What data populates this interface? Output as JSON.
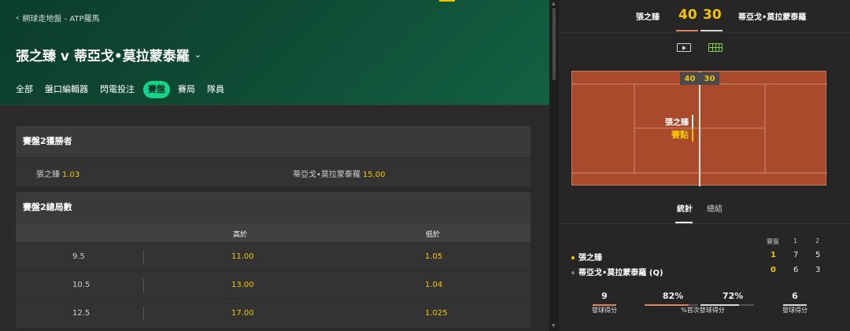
{
  "breadcrumb": "網球走地盤 - ATP羅馬",
  "match_title": "張之臻 v 蒂亞戈•莫拉蒙泰羅",
  "tabs": [
    {
      "label": "全部"
    },
    {
      "label": "盤口編輯器"
    },
    {
      "label": "閃電投注"
    },
    {
      "label": "賽盤"
    },
    {
      "label": "賽局"
    },
    {
      "label": "隊員"
    }
  ],
  "active_tab": "賽盤",
  "set_winner_market": {
    "title": "賽盤2獲勝者",
    "selections": [
      {
        "name": "張之臻",
        "odds": "1.03"
      },
      {
        "name": "蒂亞戈•莫拉蒙泰羅",
        "odds": "15.00"
      }
    ]
  },
  "total_games_market": {
    "title": "賽盤2總局數",
    "col_over": "高於",
    "col_under": "低於",
    "rows": [
      {
        "line": "9.5",
        "over": "11.00",
        "under": "1.05"
      },
      {
        "line": "10.5",
        "over": "13.00",
        "under": "1.04"
      },
      {
        "line": "12.5",
        "over": "17.00",
        "under": "1.025"
      }
    ]
  },
  "scoreboard": {
    "player1": "張之臻",
    "player2": "蒂亞戈•莫拉蒙泰羅",
    "points1": "40",
    "points2": "30",
    "underline1_color": "#e0835c",
    "underline2_color": "#d8d8d8"
  },
  "view_icons": [
    "video-icon",
    "court-view-icon"
  ],
  "court": {
    "score1": "40",
    "score2": "30",
    "server_name": "張之臻",
    "status": "賽點",
    "surface_color": "#a94a2b"
  },
  "stats_tabs": {
    "stats": "統計",
    "summary": "總結"
  },
  "sets_table": {
    "header": [
      "賽盤",
      "1",
      "2"
    ],
    "players": [
      {
        "name": "張之臻",
        "dot_color": "#f3c300",
        "cells": [
          "1",
          "7",
          "5"
        ]
      },
      {
        "name": "蒂亞戈•莫拉蒙泰羅 (Q)",
        "dot_color": "#777777",
        "cells": [
          "0",
          "6",
          "3"
        ]
      }
    ]
  },
  "serve_stats": [
    {
      "value": "9",
      "label": "發球得分",
      "fill": 1.0,
      "color": "#e0835c"
    },
    {
      "value": "82%",
      "value2": "72%",
      "label": "%首次發球得分",
      "fill1": 0.82,
      "fill2": 0.72
    },
    {
      "value": "6",
      "label": "發球得分",
      "fill": 1.0,
      "color": "#d8d8d8"
    }
  ]
}
